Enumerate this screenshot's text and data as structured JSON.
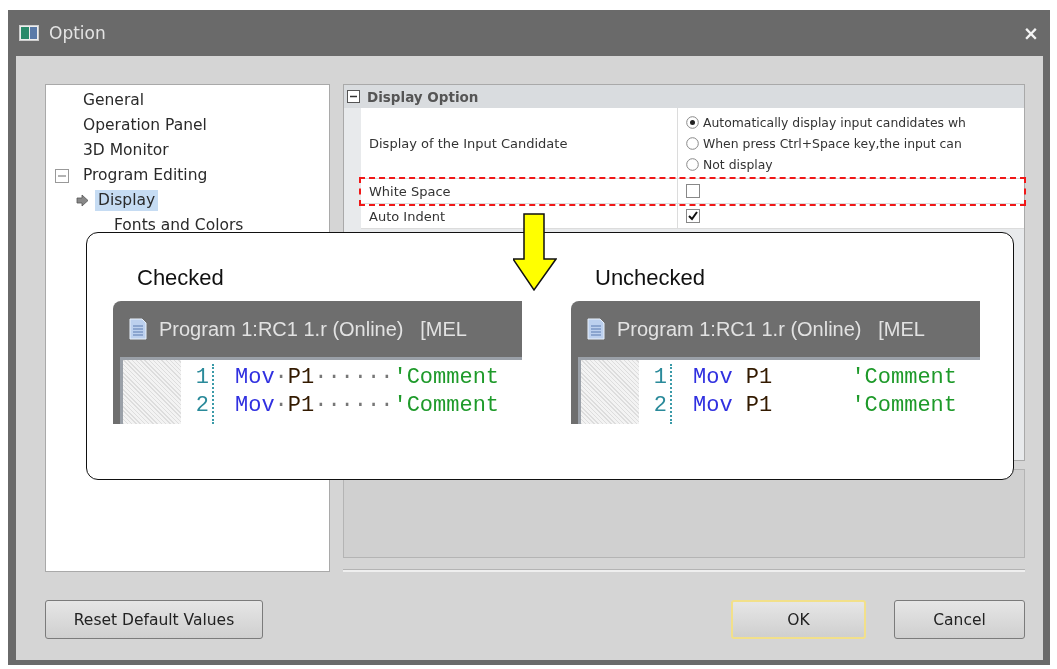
{
  "window": {
    "title": "Option",
    "close": "×"
  },
  "tree": [
    {
      "label": "General",
      "selected": false
    },
    {
      "label": "Operation Panel",
      "selected": false
    },
    {
      "label": "3D Monitor",
      "selected": false
    },
    {
      "label": "Program Editing",
      "selected": false,
      "expanded": true,
      "children": [
        {
          "label": "Display",
          "selected": true
        },
        {
          "label": "Fonts and Colors",
          "selected": false
        }
      ]
    }
  ],
  "property_grid": {
    "category": {
      "label": "Display Option",
      "expanded": true
    },
    "rows": [
      {
        "kind": "radio",
        "label": "Display of the Input Candidate",
        "highlighted": false,
        "options": [
          {
            "label": "Automatically display input candidates wh",
            "selected": true
          },
          {
            "label": "When press Ctrl+Space key,the input can",
            "selected": false
          },
          {
            "label": "Not display",
            "selected": false
          }
        ]
      },
      {
        "kind": "checkbox",
        "label": "White Space",
        "checked": false,
        "highlighted": true
      },
      {
        "kind": "checkbox",
        "label": "Auto Indent",
        "checked": true,
        "highlighted": false
      }
    ]
  },
  "callout": {
    "panels": [
      {
        "caption": "Checked",
        "window_title": "Program 1:RC1 1.r (Online)   [MEL",
        "lines": [
          {
            "number": "1",
            "tokens": [
              {
                "kind": "keyword",
                "text": "Mov"
              },
              {
                "kind": "mark",
                "text": "·"
              },
              {
                "kind": "operand",
                "text": "P1"
              },
              {
                "kind": "mark",
                "text": "······"
              },
              {
                "kind": "comment",
                "text": "'Comment"
              }
            ]
          },
          {
            "number": "2",
            "tokens": [
              {
                "kind": "keyword",
                "text": "Mov"
              },
              {
                "kind": "mark",
                "text": "·"
              },
              {
                "kind": "operand",
                "text": "P1"
              },
              {
                "kind": "mark",
                "text": "······"
              },
              {
                "kind": "comment",
                "text": "'Comment"
              }
            ]
          }
        ]
      },
      {
        "caption": "Unchecked",
        "window_title": "Program 1:RC1 1.r (Online)   [MEL",
        "lines": [
          {
            "number": "1",
            "tokens": [
              {
                "kind": "keyword",
                "text": "Mov"
              },
              {
                "kind": "operand",
                "text": "P1"
              },
              {
                "kind": "comment",
                "text": "'Comment"
              }
            ]
          },
          {
            "number": "2",
            "tokens": [
              {
                "kind": "keyword",
                "text": "Mov"
              },
              {
                "kind": "operand",
                "text": "P1"
              },
              {
                "kind": "comment",
                "text": "'Comment"
              }
            ]
          }
        ]
      }
    ]
  },
  "buttons": [
    {
      "label": "Reset Default Values",
      "default": false
    },
    {
      "label": "OK",
      "default": true
    },
    {
      "label": "Cancel",
      "default": false
    }
  ]
}
